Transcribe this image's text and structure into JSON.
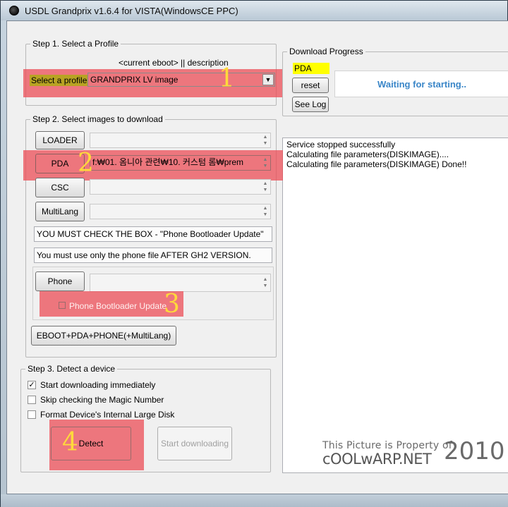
{
  "window": {
    "title": "USDL Grandprix v1.6.4 for VISTA(WindowsCE PPC)"
  },
  "step1": {
    "group_title": "Step 1. Select a Profile",
    "column_header": "<current eboot> || description",
    "profile_label": "Select a profile",
    "profile_value": "GRANDPRIX LV image"
  },
  "download_progress": {
    "group_title": "Download Progress",
    "badge": "PDA",
    "reset_label": "reset",
    "see_log_label": "See Log",
    "status": "Waiting for starting.."
  },
  "step2": {
    "group_title": "Step 2. Select images to download",
    "loader_label": "LOADER",
    "loader_value": "",
    "pda_label": "PDA",
    "pda_value": "f:₩01. 옴니아 관련₩10. 커스텀 롬₩prem",
    "csc_label": "CSC",
    "csc_value": "",
    "multilang_label": "MultiLang",
    "multilang_value": "",
    "notice1": "YOU MUST CHECK THE BOX  -  \"Phone Bootloader Update\"",
    "notice2": "You must use only the phone file AFTER  GH2 VERSION.",
    "phone_label": "Phone",
    "phone_value": "",
    "bootloader_checkbox_label": "Phone Bootloader Update",
    "bootloader_checked": false,
    "eboot_button_label": "EBOOT+PDA+PHONE(+MultiLang)"
  },
  "step3": {
    "group_title": "Step 3. Detect a device",
    "options": [
      {
        "label": "Start downloading immediately",
        "checked": true
      },
      {
        "label": "Skip checking the Magic Number",
        "checked": false
      },
      {
        "label": "Format Device's Internal Large Disk",
        "checked": false
      }
    ],
    "detect_label": "Detect",
    "start_label": "Start downloading"
  },
  "log": {
    "lines": [
      "Service stopped successfully",
      "Calculating file parameters(DISKIMAGE)....",
      "Calculating file parameters(DISKIMAGE) Done!!"
    ]
  },
  "watermark": {
    "line1": "This Picture is Property of",
    "line2": "cOOLwARP.NET",
    "year": "2010"
  },
  "annotations": {
    "step1": "1",
    "step2": "2",
    "step3": "3",
    "step4": "4"
  },
  "colors": {
    "highlight": "#eb4650",
    "badge_yellow": "#ffff00",
    "status_blue": "#3a86c8",
    "annotation_yellow": "#ffd93b"
  },
  "icons": {
    "app": "app-icon",
    "dropdown": "chevron-down-icon",
    "spin": "spin-arrows-icon",
    "check": "check-icon"
  }
}
